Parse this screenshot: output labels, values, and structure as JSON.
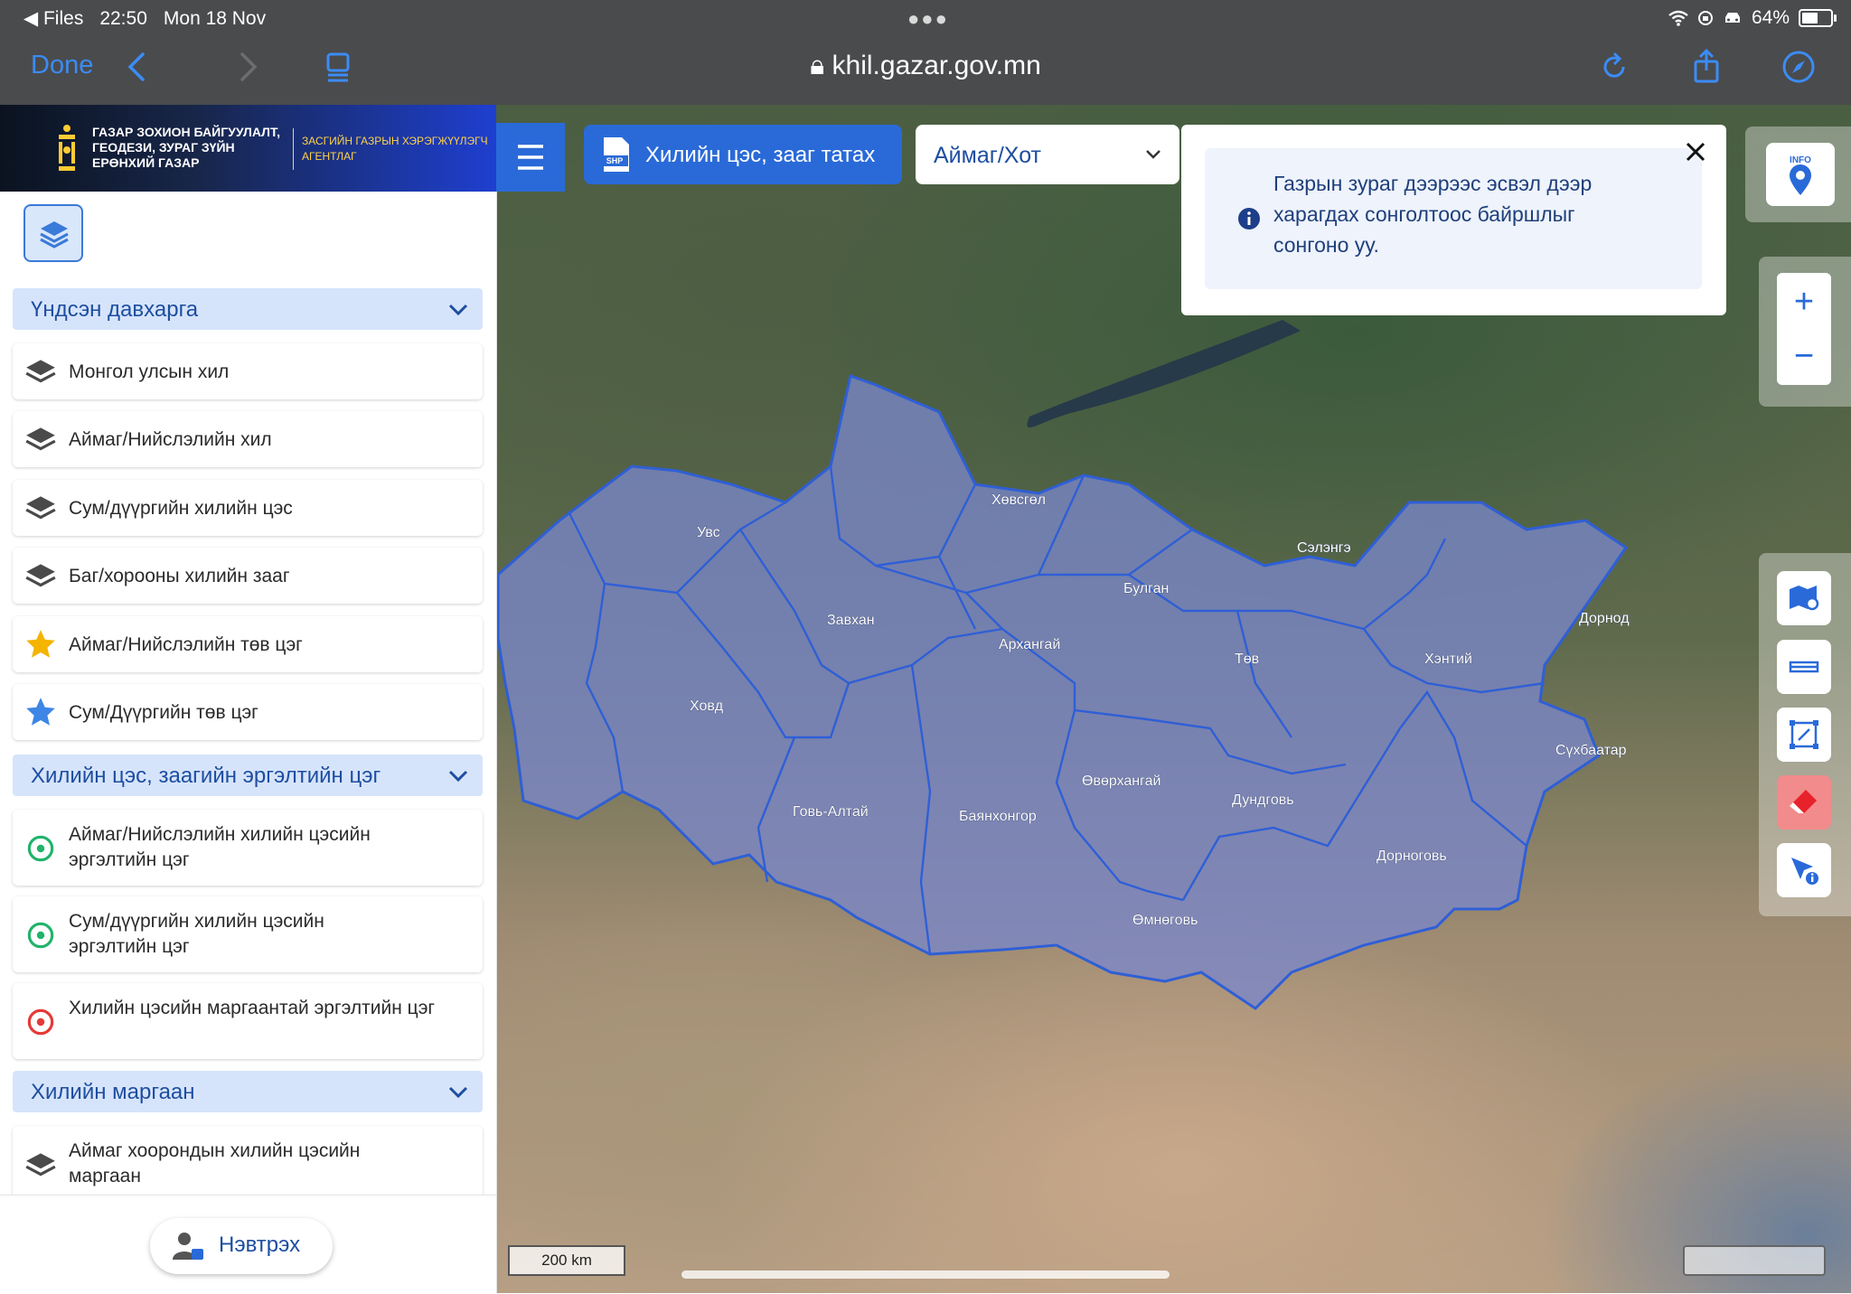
{
  "status_bar": {
    "back_app": "Files",
    "time": "22:50",
    "date": "Mon 18 Nov",
    "battery": "64%",
    "battery_level": 0.64
  },
  "browser": {
    "done_label": "Done",
    "url": "khil.gazar.gov.mn"
  },
  "brand": {
    "org_name": "ГАЗАР ЗОХИОН БАЙГУУЛАЛТ, ГЕОДЕЗИ, ЗУРАГ ЗҮЙН ЕРӨНХИЙ ГАЗАР",
    "agency": "ЗАСГИЙН ГАЗРЫН ХЭРЭГЖҮҮЛЭГЧ АГЕНТЛАГ"
  },
  "sidebar": {
    "groups": [
      {
        "title": "Үндсэн давхарга",
        "items": [
          {
            "label": "Монгол улсын хил",
            "icon": "layers-icon"
          },
          {
            "label": "Аймаг/Нийслэлийн хил",
            "icon": "layers-icon"
          },
          {
            "label": "Сум/дүүргийн хилийн цэс",
            "icon": "layers-icon"
          },
          {
            "label": "Баг/хорооны хилийн зааг",
            "icon": "layers-icon"
          },
          {
            "label": "Аймаг/Нийслэлийн төв цэг",
            "icon": "star-icon",
            "color": "#f4b400"
          },
          {
            "label": "Сум/Дүүргийн төв цэг",
            "icon": "star-icon",
            "color": "#3d86e6"
          }
        ]
      },
      {
        "title": "Хилийн цэс, заагийн эргэлтийн цэг",
        "items": [
          {
            "label": "Аймаг/Нийслэлийн хилийн цэсийн эргэлтийн цэг",
            "icon": "target-icon",
            "color": "#21b36b"
          },
          {
            "label": "Сум/дүүргийн хилийн цэсийн эргэлтийн цэг",
            "icon": "target-icon",
            "color": "#21b36b"
          },
          {
            "label": "Хилийн цэсийн маргаантай эргэлтийн цэг",
            "icon": "target-icon",
            "color": "#e53935"
          }
        ]
      },
      {
        "title": "Хилийн маргаан",
        "items": [
          {
            "label": "Аймаг хоорондын хилийн цэсийн маргаан",
            "icon": "layers-icon"
          }
        ]
      }
    ],
    "login_label": "Нэвтрэх"
  },
  "toolbar": {
    "shp_badge": "SHP",
    "draw_button": "Хилийн цэс, зааг татах",
    "select_value": "Аймаг/Хот"
  },
  "notice": {
    "text": "Газрын зураг дээрээс эсвэл дээр харагдах сонголтоос байршлыг сонгоно уу."
  },
  "map": {
    "info_badge": "INFO",
    "scale_label": "200 km",
    "provinces": [
      "Увс",
      "Хөвсгөл",
      "Сэлэнгэ",
      "Булган",
      "Завхан",
      "Архангай",
      "Дорнод",
      "Хэнтий",
      "Төв",
      "Ховд",
      "Сүхбаатар",
      "Өвөрхангай",
      "Говь-Алтай",
      "Баянхонгор",
      "Дундговь",
      "Дорноговь",
      "Өмнөговь"
    ],
    "overlay_color": "#7a87c9",
    "border_color": "#2f5fd6"
  },
  "colors": {
    "accent": "#2a6ad8",
    "group_bg": "#d6e4fb",
    "group_text": "#1d4ea0"
  }
}
